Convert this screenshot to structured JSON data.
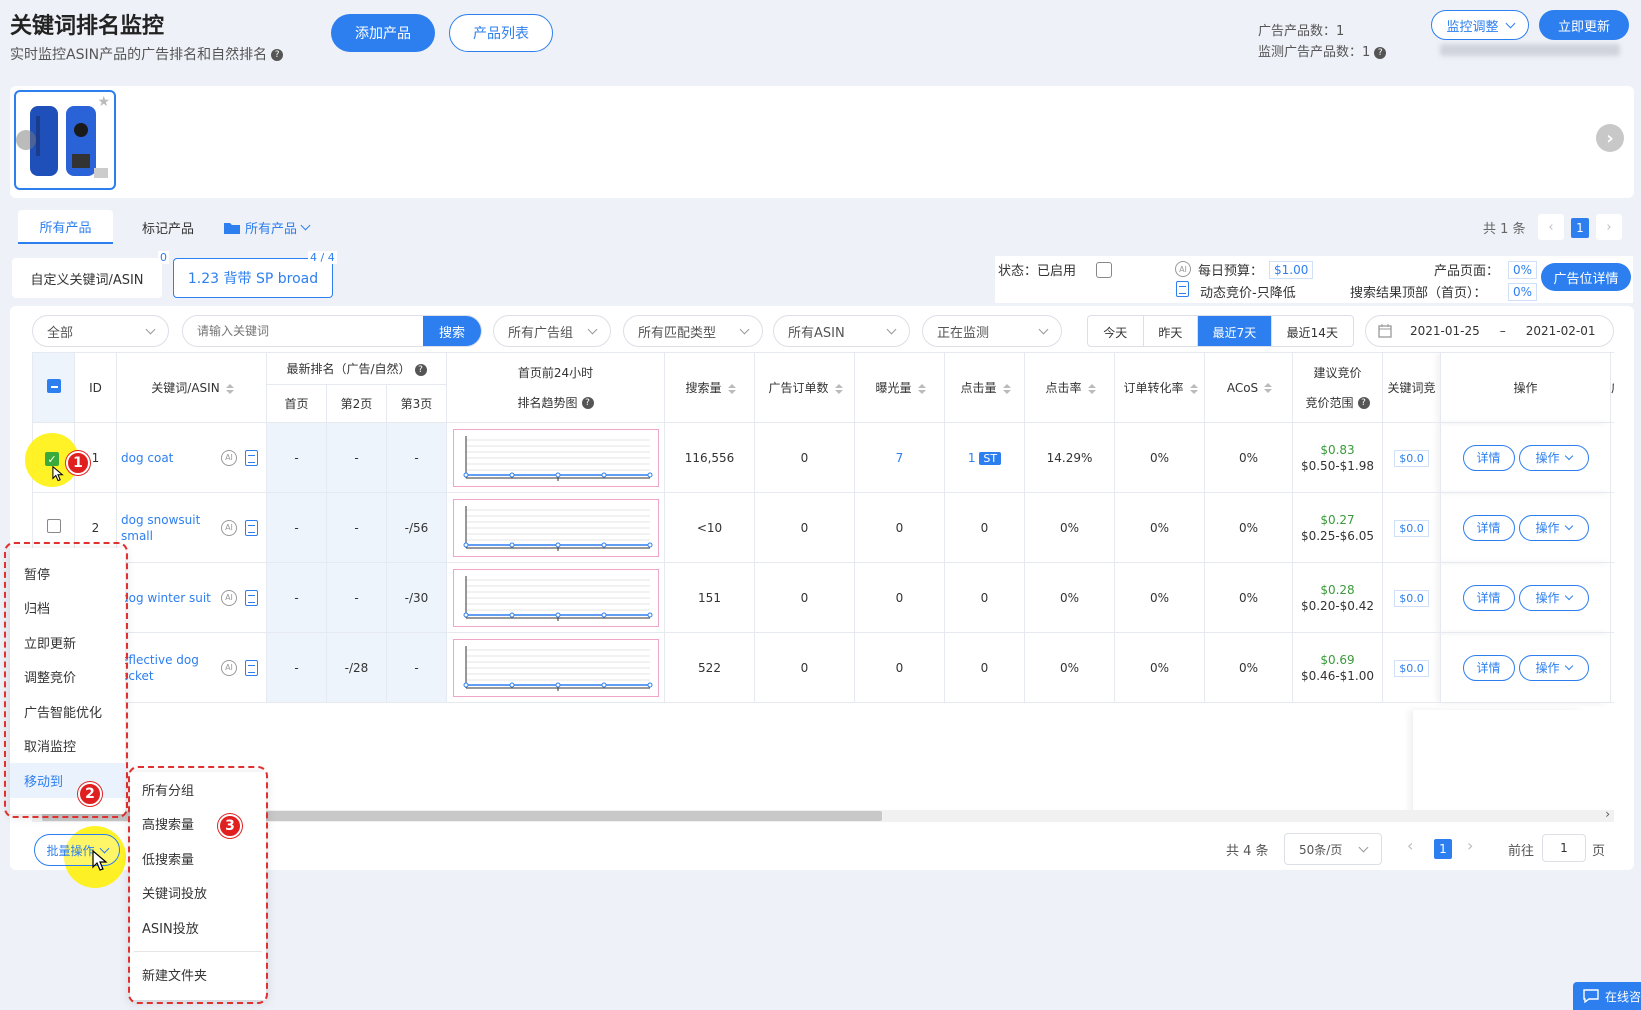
{
  "header": {
    "title": "关键词排名监控",
    "subtitle": "实时监控ASIN产品的广告排名和自然排名",
    "add_product_label": "添加产品",
    "product_list_label": "产品列表",
    "ad_product_count_label": "广告产品数：",
    "ad_product_count": "1",
    "monitored_ad_product_label": "监测广告产品数：",
    "monitored_ad_product_count": "1",
    "monitor_adjust_label": "监控调整",
    "update_now_label": "立即更新"
  },
  "filter_tabs": {
    "all_products": "所有产品",
    "marked_products": "标记产品",
    "folder_label": "所有产品",
    "total_label": "共 1 条",
    "page": "1"
  },
  "groups": {
    "custom_label": "自定义关键词/ASIN",
    "custom_count": "0",
    "active_label": "1.23 背带 SP broad",
    "active_count": "4 / 4"
  },
  "status_bar": {
    "status_label": "状态：",
    "status_value": "已启用",
    "daily_budget_label": "每日预算：",
    "daily_budget_value": "$1.00",
    "bid_strategy": "动态竞价-只降低",
    "product_page_label": "产品页面：",
    "product_page_value": "0%",
    "search_top_label": "搜索结果顶部（首页）：",
    "search_top_value": "0%",
    "ad_detail_label": "广告位详情"
  },
  "toolbar": {
    "scope_select": "全部",
    "keyword_placeholder": "请输入关键词",
    "search_label": "搜索",
    "ad_group_select": "所有广告组",
    "match_type_select": "所有匹配类型",
    "asin_select": "所有ASIN",
    "monitor_select": "正在监测",
    "ranges": [
      "今天",
      "昨天",
      "最近7天",
      "最近14天"
    ],
    "active_range": "最近7天",
    "date_start": "2021-01-25",
    "date_sep": "–",
    "date_end": "2021-02-01"
  },
  "table": {
    "headers": {
      "id": "ID",
      "keyword": "关键词/ASIN",
      "latest_rank": "最新排名（广告/自然）",
      "page1": "首页",
      "page2": "第2页",
      "page3": "第3页",
      "trend_title": "首页前24小时",
      "trend_sub": "排名趋势图",
      "search_volume": "搜索量",
      "ad_orders": "广告订单数",
      "impressions": "曝光量",
      "clicks": "点击量",
      "ctr": "点击率",
      "cvr": "订单转化率",
      "acos": "ACoS",
      "suggest_bid": "建议竞价",
      "bid_range": "竞价范围",
      "keyword_bid": "关键词竞",
      "actions": "操作",
      "more": "广告"
    },
    "rows": [
      {
        "id": "1",
        "keyword": "dog coat",
        "p1": "-",
        "p2": "-",
        "p3": "-",
        "search": "116,556",
        "orders": "0",
        "impr": "7",
        "clicks": "1",
        "st": "ST",
        "ctr": "14.29%",
        "cvr": "0%",
        "acos": "0%",
        "bid": "$0.83",
        "range": "$0.50-$1.98",
        "kwbid": "$0.0",
        "checked": true
      },
      {
        "id": "2",
        "keyword": "dog snowsuit small",
        "p1": "-",
        "p2": "-",
        "p3": "-/56",
        "search": "<10",
        "orders": "0",
        "impr": "0",
        "clicks": "0",
        "st": "",
        "ctr": "0%",
        "cvr": "0%",
        "acos": "0%",
        "bid": "$0.27",
        "range": "$0.25-$6.05",
        "kwbid": "$0.0",
        "checked": false
      },
      {
        "id": "",
        "keyword": "dog winter suit",
        "p1": "-",
        "p2": "-",
        "p3": "-/30",
        "search": "151",
        "orders": "0",
        "impr": "0",
        "clicks": "0",
        "st": "",
        "ctr": "0%",
        "cvr": "0%",
        "acos": "0%",
        "bid": "$0.28",
        "range": "$0.20-$0.42",
        "kwbid": "$0.0",
        "checked": false
      },
      {
        "id": "",
        "keyword": "eflective dog acket",
        "p1": "-",
        "p2": "-/28",
        "p3": "-",
        "search": "522",
        "orders": "0",
        "impr": "0",
        "clicks": "0",
        "st": "",
        "ctr": "0%",
        "cvr": "0%",
        "acos": "0%",
        "bid": "$0.69",
        "range": "$0.46-$1.00",
        "kwbid": "$0.0",
        "checked": false
      }
    ],
    "detail_label": "详情",
    "operate_label": "操作"
  },
  "batch_menu": {
    "items": [
      "暂停",
      "归档",
      "立即更新",
      "调整竞价",
      "广告智能优化",
      "取消监控",
      "移动到"
    ],
    "trigger_label": "批量操作"
  },
  "move_menu": {
    "items": [
      "所有分组",
      "高搜索量",
      "低搜索量",
      "关键词投放",
      "ASIN投放",
      "新建文件夹"
    ]
  },
  "pagination": {
    "total": "共 4 条",
    "page_size": "50条/页",
    "current": "1",
    "goto_label": "前往",
    "goto_value": "1",
    "page_unit": "页"
  },
  "annotations": [
    "1",
    "2",
    "3"
  ],
  "chat": {
    "label": "在线咨"
  }
}
